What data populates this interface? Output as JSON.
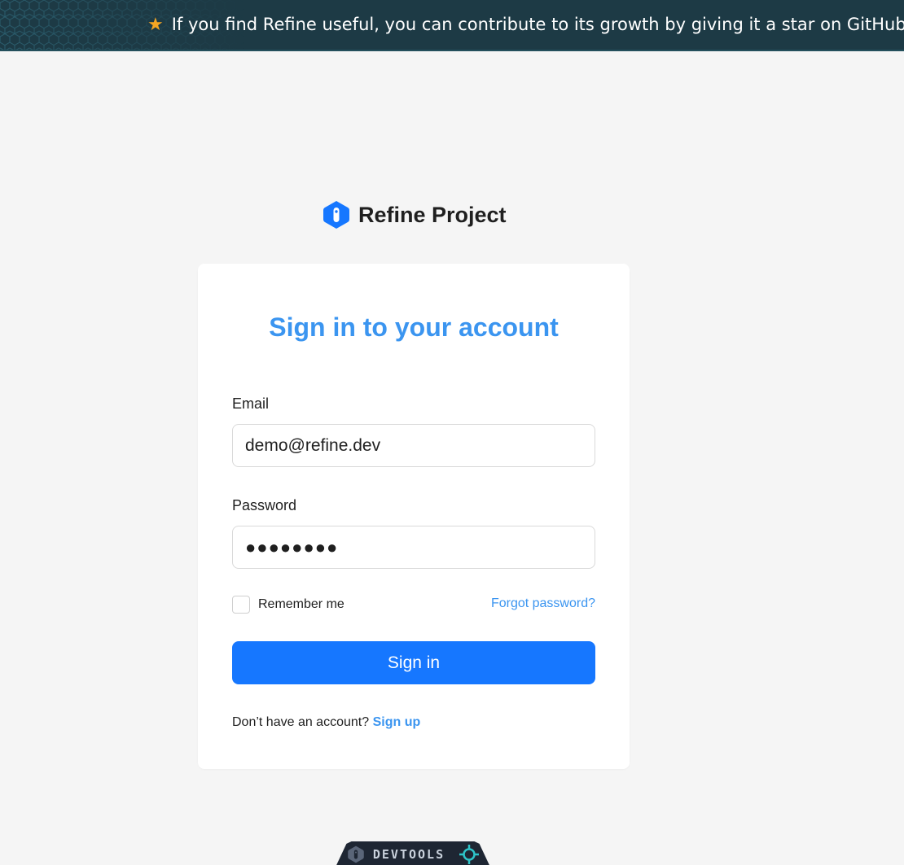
{
  "banner": {
    "text": "If you find Refine useful, you can contribute to its growth by giving it a star on GitHub",
    "star_icon": "star-icon",
    "background": "#1d3a45",
    "star_color": "#f5a623"
  },
  "brand": {
    "name": "Refine Project",
    "logo_icon": "refine-logo-icon",
    "logo_color": "#1677ff"
  },
  "login": {
    "title": "Sign in to your account",
    "email_label": "Email",
    "email_value": "demo@refine.dev",
    "password_label": "Password",
    "password_value": "●●●●●●●●",
    "remember_label": "Remember me",
    "remember_checked": false,
    "forgot_label": "Forgot password?",
    "signin_label": "Sign in",
    "no_account_text": "Don’t have an account?",
    "signup_label": "Sign up",
    "accent_color": "#3b95f0",
    "button_color": "#1677ff"
  },
  "devtools": {
    "label": "DEVTOOLS",
    "logo_icon": "refine-logo-icon",
    "target_icon": "crosshair-icon"
  }
}
